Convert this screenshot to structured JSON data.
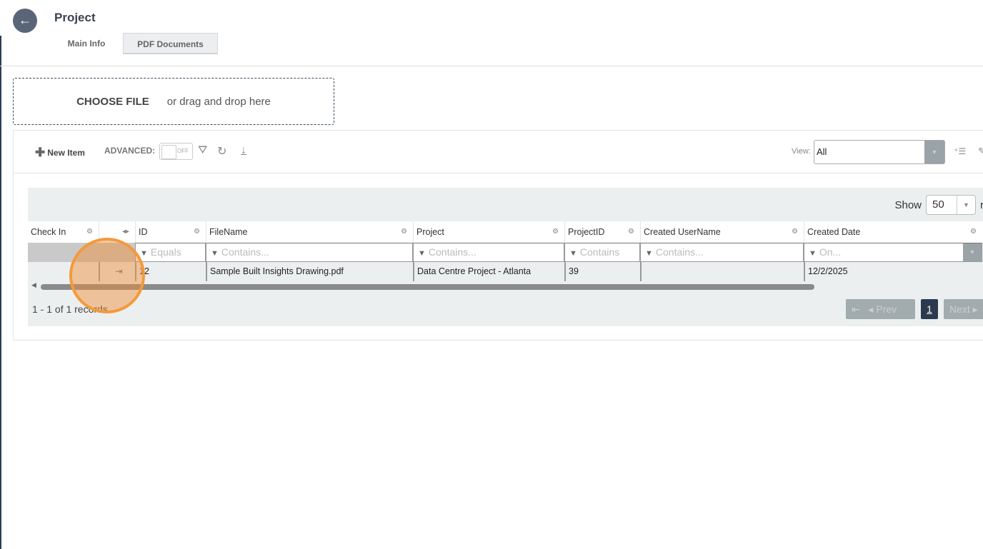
{
  "header": {
    "title": "Project",
    "back_icon": "arrow-left-icon",
    "tabs": [
      {
        "label": "Main Info",
        "active": false
      },
      {
        "label": "PDF Documents",
        "active": true
      }
    ]
  },
  "upload": {
    "choose_label": "CHOOSE FILE",
    "drop_text": "or drag and drop here"
  },
  "toolbar": {
    "new_item": "New Item",
    "advanced_label": "ADVANCED:",
    "advanced_state": "OFF",
    "view_label": "View:",
    "view_value": "All"
  },
  "grid": {
    "show_label": "Show",
    "page_size": "50",
    "records_suffix": "r",
    "columns": [
      "Check In",
      "",
      "ID",
      "FileName",
      "Project",
      "ProjectID",
      "Created UserName",
      "Created Date"
    ],
    "filters": [
      "",
      "",
      "Equals",
      "Contains...",
      "Contains...",
      "Contains",
      "Contains...",
      "On..."
    ],
    "rows": [
      {
        "check_in": "",
        "id": "12",
        "file_name": "Sample Built Insights Drawing.pdf",
        "project": "Data Centre Project - Atlanta",
        "project_id": "39",
        "created_user": "",
        "created_date": "12/2/2025"
      }
    ],
    "records_text": "1 - 1 of 1 records",
    "pager": {
      "prev": "Prev",
      "current": "1",
      "next": "Next"
    }
  },
  "colors": {
    "highlight": "#f39a3c",
    "accent": "#2b3a4e"
  }
}
